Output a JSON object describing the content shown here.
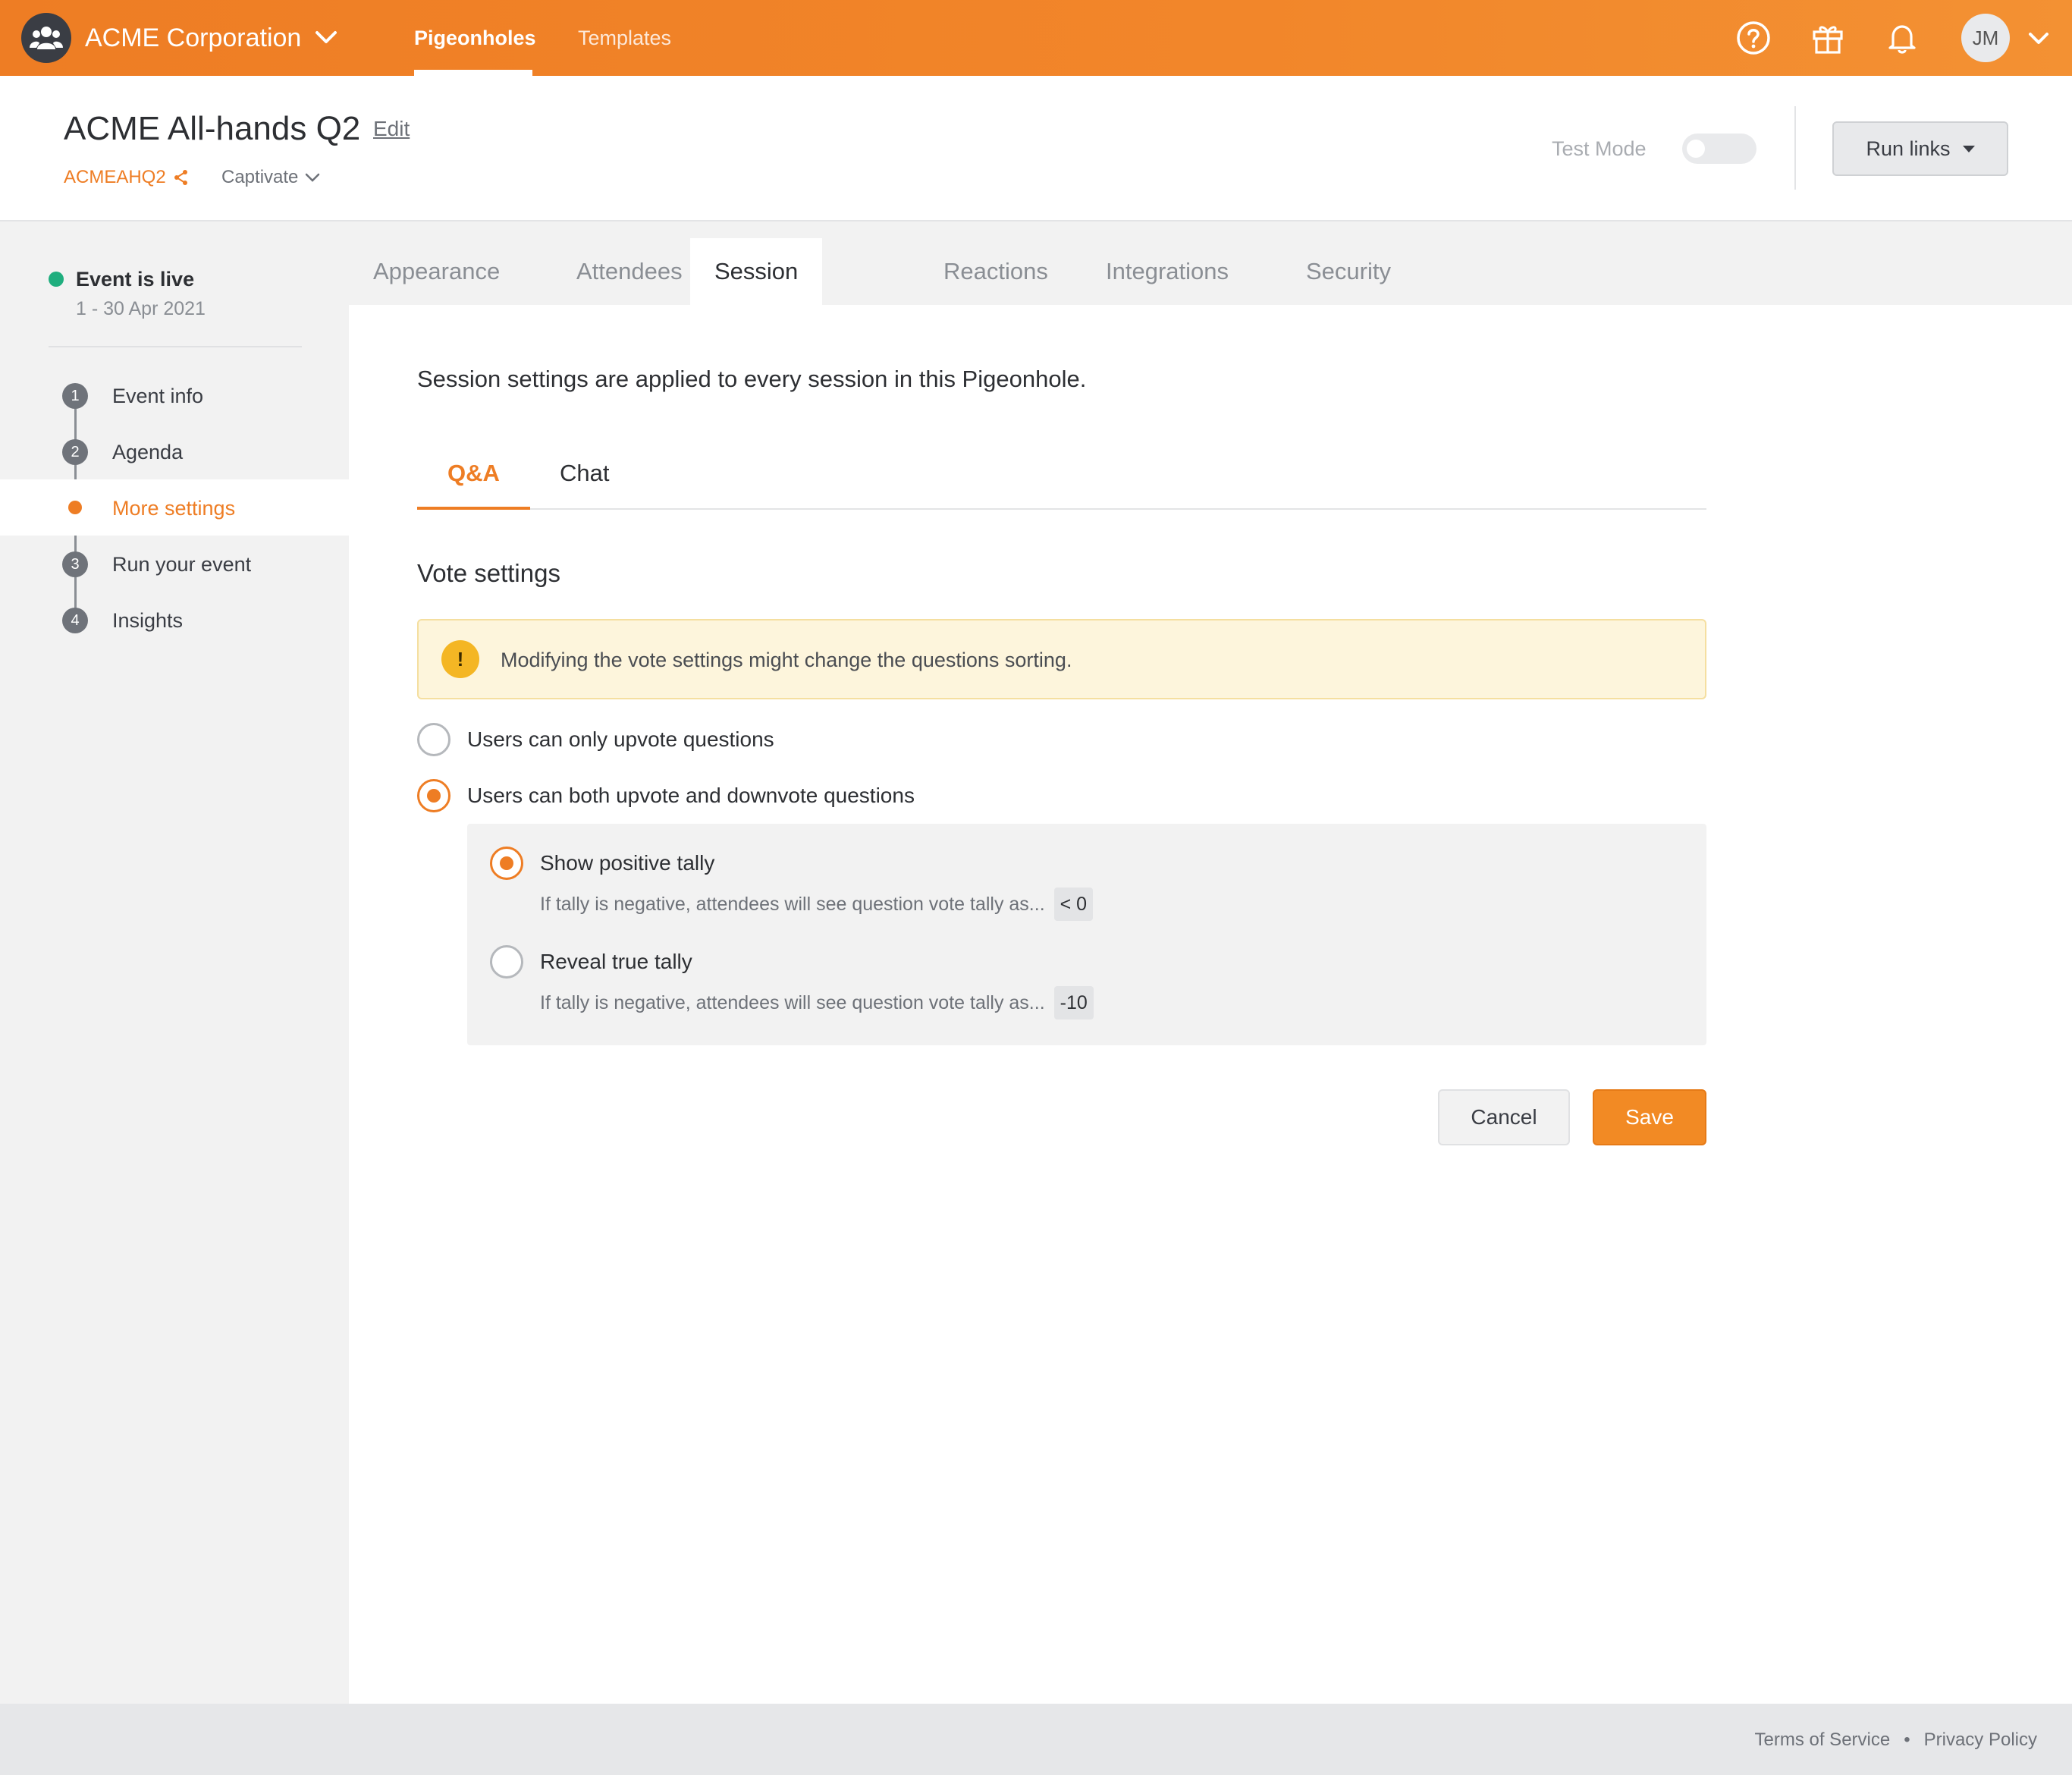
{
  "topbar": {
    "org_name": "ACME Corporation",
    "nav_tabs": [
      {
        "label": "Pigeonholes",
        "active": true
      },
      {
        "label": "Templates",
        "active": false
      }
    ],
    "icons": [
      "help-icon",
      "gift-icon",
      "bell-icon"
    ],
    "avatar_initials": "JM",
    "accent_color": "#ee7d24"
  },
  "event": {
    "title": "ACME All-hands Q2",
    "edit_label": "Edit",
    "code": "ACMEAHQ2",
    "product": "Captivate",
    "test_mode_label": "Test Mode",
    "test_mode_on": false,
    "run_links_label": "Run links"
  },
  "sidebar": {
    "status": "Event is live",
    "dates": "1 - 30 Apr 2021",
    "status_color": "#1fae7e",
    "steps": [
      {
        "num": "1",
        "label": "Event info"
      },
      {
        "num": "2",
        "label": "Agenda"
      },
      {
        "num": "",
        "label": "More settings",
        "active": true
      },
      {
        "num": "3",
        "label": "Run your event"
      },
      {
        "num": "4",
        "label": "Insights"
      }
    ]
  },
  "settings_tabs": [
    {
      "label": "Appearance"
    },
    {
      "label": "Attendees"
    },
    {
      "label": "Session settings",
      "active": true
    },
    {
      "label": "Reactions"
    },
    {
      "label": "Integrations"
    },
    {
      "label": "Security"
    }
  ],
  "main": {
    "intro": "Session settings are applied to every session in this Pigeonhole.",
    "subtabs": [
      {
        "label": "Q&A",
        "active": true
      },
      {
        "label": "Chat"
      }
    ],
    "section_title": "Vote settings",
    "warning": "Modifying the vote settings might change the questions sorting.",
    "vote_options": [
      {
        "label": "Users can only upvote questions",
        "checked": false
      },
      {
        "label": "Users can both upvote and downvote questions",
        "checked": true
      }
    ],
    "tally_options": [
      {
        "label": "Show positive tally",
        "checked": true,
        "help": "If tally is negative, attendees will see question vote tally as...",
        "example": "< 0"
      },
      {
        "label": "Reveal true tally",
        "checked": false,
        "help": "If tally is negative, attendees will see question vote tally as...",
        "example": "-10"
      }
    ],
    "cancel_label": "Cancel",
    "save_label": "Save"
  },
  "footer": {
    "terms": "Terms of Service",
    "separator": "•",
    "privacy": "Privacy Policy"
  }
}
